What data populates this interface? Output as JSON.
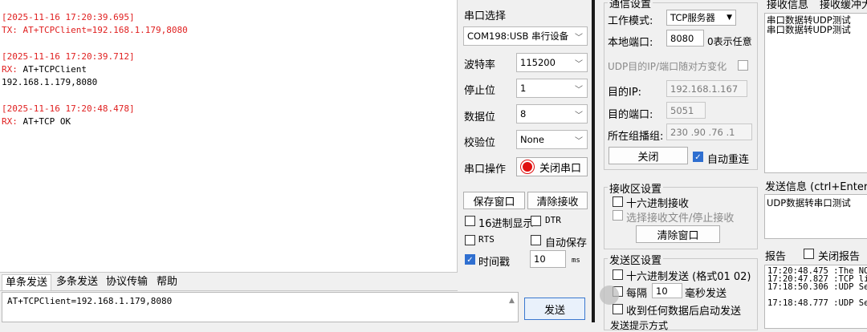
{
  "log": [
    {
      "text": "[2025-11-16 17:20:39.695]",
      "cls": "red"
    },
    {
      "text": "TX: AT+TCPClient=192.168.1.179,8080",
      "cls": "red"
    },
    {
      "text": "",
      "cls": "blank"
    },
    {
      "text": "[2025-11-16 17:20:39.712]",
      "cls": "red"
    },
    {
      "text": "RX: AT+TCPClient",
      "cls": "mix"
    },
    {
      "text": "192.168.1.179,8080",
      "cls": ""
    },
    {
      "text": "",
      "cls": "blank"
    },
    {
      "text": "[2025-11-16 17:20:48.478]",
      "cls": "red"
    },
    {
      "text": "RX: AT+TCP OK",
      "cls": "mix"
    }
  ],
  "serial": {
    "title": "串口选择",
    "port": "COM198:USB 串行设备",
    "baud_label": "波特率",
    "baud": "115200",
    "stop_label": "停止位",
    "stop": "1",
    "data_label": "数据位",
    "data": "8",
    "parity_label": "校验位",
    "parity": "None",
    "op_label": "串口操作",
    "close_port": "关闭串口",
    "save_window": "保存窗口",
    "clear_recv": "清除接收",
    "hex_display": "16进制显示",
    "dtr": "DTR",
    "rts": "RTS",
    "auto_save": "自动保存",
    "timestamp": "时间戳",
    "ts_value": "10",
    "ts_unit": "ms"
  },
  "tabs": [
    "单条发送",
    "多条发送",
    "协议传输",
    "帮助"
  ],
  "send": {
    "text": "AT+TCPClient=192.168.1.179,8080",
    "button": "发送"
  },
  "net": {
    "title": "通信设置",
    "mode_label": "工作模式:",
    "mode": "TCP服务器",
    "port_label": "本地端口:",
    "port": "8080",
    "port_hint": "0表示任意",
    "udp_random": "UDP目的IP/端口随对方变化",
    "ip_label": "目的IP:",
    "ip": "192.168.1.167",
    "dport_label": "目的端口:",
    "dport": "5051",
    "group_label": "所在组播组:",
    "group": "230 .90 .76 .1",
    "close": "关闭",
    "auto_reconnect": "自动重连"
  },
  "recv": {
    "title": "接收区设置",
    "hex": "十六进制接收",
    "to_file": "选择接收文件/停止接收",
    "clear": "清除窗口"
  },
  "sendset": {
    "title": "发送区设置",
    "hex": "十六进制发送 (格式01 02)",
    "every": "每隔",
    "interval": "10",
    "unit": "毫秒发送",
    "on_recv": "收到任何数据后启动发送",
    "cut": "发送提示方式"
  },
  "right": {
    "recv_info": "接收信息",
    "recv_buf": "接收缓冲大",
    "recv_lines": [
      "串口数据转UDP测试",
      "串口数据转UDP测试"
    ],
    "send_info": "发送信息 (ctrl+Enter发",
    "send_text": "UDP数据转串口测试",
    "report": "报告",
    "close_report": "关闭报告",
    "report_lines": [
      "17:20:48.475 :The NO",
      "17:20:47.827 :TCP li",
      "17:18:50.306 :UDP Se",
      "",
      "17:18:48.777 :UDP Se"
    ]
  }
}
